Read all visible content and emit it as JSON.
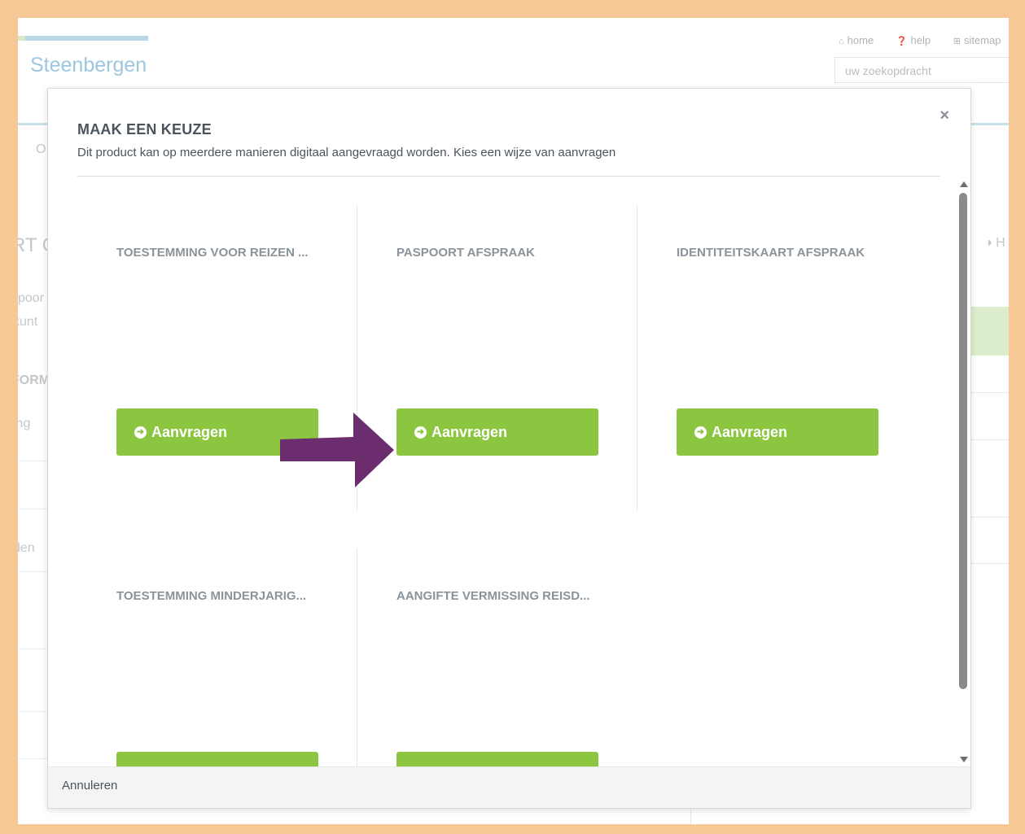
{
  "site": {
    "title": "Steenbergen",
    "top_links": [
      "home",
      "help",
      "sitemap"
    ],
    "search_placeholder": "uw zoekopdracht",
    "bg_fragments": {
      "nav_o": "O",
      "heading": "RT O",
      "line1": "spoor",
      "line2": "kunt",
      "section": "FORM",
      "item1": "ing",
      "item2": "den",
      "right": "◑ H"
    }
  },
  "modal": {
    "title": "MAAK EEN KEUZE",
    "subtitle": "Dit product kan op meerdere manieren digitaal aangevraagd worden. Kies een wijze van aanvragen",
    "close_glyph": "×",
    "options": [
      {
        "title": "TOESTEMMING VOOR REIZEN ...",
        "button": "Aanvragen"
      },
      {
        "title": "PASPOORT AFSPRAAK",
        "button": "Aanvragen"
      },
      {
        "title": "IDENTITEITSKAART AFSPRAAK",
        "button": "Aanvragen"
      },
      {
        "title": "TOESTEMMING MINDERJARIG...",
        "button": ""
      },
      {
        "title": "AANGIFTE VERMISSING REISD...",
        "button": ""
      }
    ],
    "cancel_label": "Annuleren"
  },
  "colors": {
    "frame": "#f5c896",
    "button_green": "#8cc53f",
    "arrow_purple": "#6b2d6e",
    "site_blue": "#9cc7de"
  },
  "icons": {
    "home": "home-icon",
    "help": "question-circle-icon",
    "sitemap": "sitemap-icon",
    "button": "arrow-circle-right-icon",
    "close": "close-icon"
  }
}
